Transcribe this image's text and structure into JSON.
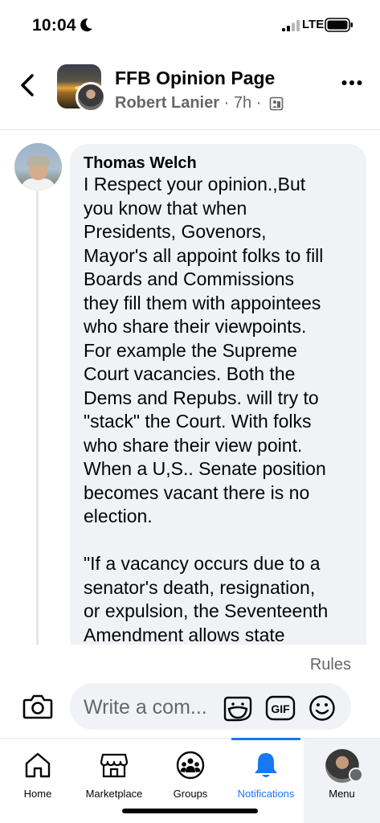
{
  "status_bar": {
    "time": "10:04",
    "network": "LTE",
    "icons": [
      "moon-icon",
      "signal-icon",
      "battery-icon"
    ]
  },
  "header": {
    "group_name": "FFB Opinion Page",
    "author": "Robert Lanier",
    "separator": "·",
    "timestamp": "7h",
    "icons": [
      "back-arrow-icon",
      "privacy-icon",
      "more-icon"
    ]
  },
  "comment": {
    "author": "Thomas Welch",
    "paragraph_1": "I Respect your opinion.,But\nyou know that when\nPresidents, Govenors,\nMayor's all appoint folks to fill\nBoards and Commissions\nthey fill them with appointees\nwho share their viewpoints.\nFor example the Supreme\nCourt vacancies. Both the\nDems and Repubs. will try to\n\"stack\" the Court. With folks\nwho share their view point.\nWhen  a U,S.. Senate position\nbecomes   vacant there is no\nelection.",
    "paragraph_2": "\"If a vacancy occurs due to a\nsenator's death, resignation,\nor expulsion, the Seventeenth\nAmendment allows state"
  },
  "composer": {
    "rules_label": "Rules",
    "placeholder": "Write a com...",
    "icons": [
      "camera-icon",
      "sticker-icon",
      "gif-icon",
      "emoji-icon"
    ]
  },
  "tabs": [
    {
      "label": "Home",
      "icon": "home-icon",
      "active": false
    },
    {
      "label": "Marketplace",
      "icon": "marketplace-icon",
      "active": false
    },
    {
      "label": "Groups",
      "icon": "groups-icon",
      "active": false
    },
    {
      "label": "Notifications",
      "icon": "bell-icon",
      "active": true
    },
    {
      "label": "Menu",
      "icon": "profile-avatar",
      "active": false
    }
  ],
  "colors": {
    "accent": "#1877f2",
    "text_primary": "#050505",
    "text_secondary": "#65676b",
    "bubble": "#f0f2f5"
  }
}
